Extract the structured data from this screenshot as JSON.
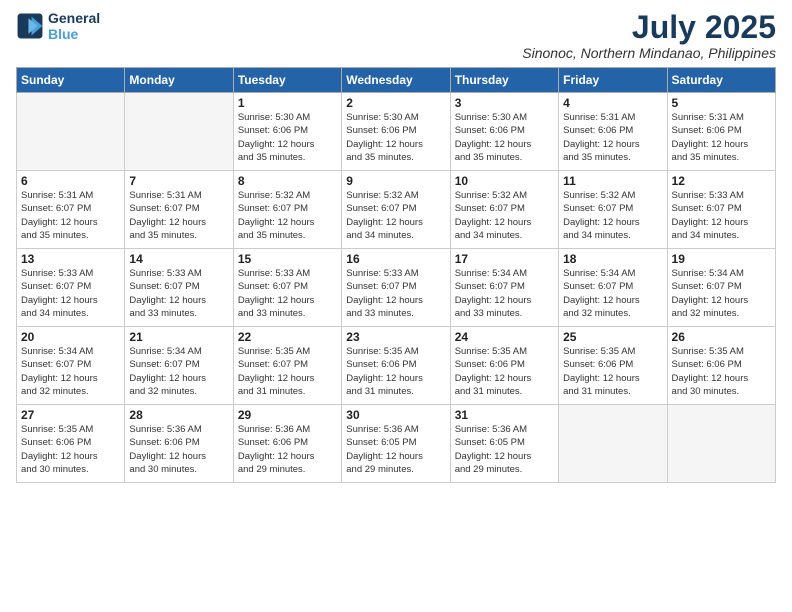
{
  "logo": {
    "line1": "General",
    "line2": "Blue"
  },
  "title": "July 2025",
  "subtitle": "Sinonoc, Northern Mindanao, Philippines",
  "headers": [
    "Sunday",
    "Monday",
    "Tuesday",
    "Wednesday",
    "Thursday",
    "Friday",
    "Saturday"
  ],
  "weeks": [
    [
      {
        "day": "",
        "info": ""
      },
      {
        "day": "",
        "info": ""
      },
      {
        "day": "1",
        "info": "Sunrise: 5:30 AM\nSunset: 6:06 PM\nDaylight: 12 hours\nand 35 minutes."
      },
      {
        "day": "2",
        "info": "Sunrise: 5:30 AM\nSunset: 6:06 PM\nDaylight: 12 hours\nand 35 minutes."
      },
      {
        "day": "3",
        "info": "Sunrise: 5:30 AM\nSunset: 6:06 PM\nDaylight: 12 hours\nand 35 minutes."
      },
      {
        "day": "4",
        "info": "Sunrise: 5:31 AM\nSunset: 6:06 PM\nDaylight: 12 hours\nand 35 minutes."
      },
      {
        "day": "5",
        "info": "Sunrise: 5:31 AM\nSunset: 6:06 PM\nDaylight: 12 hours\nand 35 minutes."
      }
    ],
    [
      {
        "day": "6",
        "info": "Sunrise: 5:31 AM\nSunset: 6:07 PM\nDaylight: 12 hours\nand 35 minutes."
      },
      {
        "day": "7",
        "info": "Sunrise: 5:31 AM\nSunset: 6:07 PM\nDaylight: 12 hours\nand 35 minutes."
      },
      {
        "day": "8",
        "info": "Sunrise: 5:32 AM\nSunset: 6:07 PM\nDaylight: 12 hours\nand 35 minutes."
      },
      {
        "day": "9",
        "info": "Sunrise: 5:32 AM\nSunset: 6:07 PM\nDaylight: 12 hours\nand 34 minutes."
      },
      {
        "day": "10",
        "info": "Sunrise: 5:32 AM\nSunset: 6:07 PM\nDaylight: 12 hours\nand 34 minutes."
      },
      {
        "day": "11",
        "info": "Sunrise: 5:32 AM\nSunset: 6:07 PM\nDaylight: 12 hours\nand 34 minutes."
      },
      {
        "day": "12",
        "info": "Sunrise: 5:33 AM\nSunset: 6:07 PM\nDaylight: 12 hours\nand 34 minutes."
      }
    ],
    [
      {
        "day": "13",
        "info": "Sunrise: 5:33 AM\nSunset: 6:07 PM\nDaylight: 12 hours\nand 34 minutes."
      },
      {
        "day": "14",
        "info": "Sunrise: 5:33 AM\nSunset: 6:07 PM\nDaylight: 12 hours\nand 33 minutes."
      },
      {
        "day": "15",
        "info": "Sunrise: 5:33 AM\nSunset: 6:07 PM\nDaylight: 12 hours\nand 33 minutes."
      },
      {
        "day": "16",
        "info": "Sunrise: 5:33 AM\nSunset: 6:07 PM\nDaylight: 12 hours\nand 33 minutes."
      },
      {
        "day": "17",
        "info": "Sunrise: 5:34 AM\nSunset: 6:07 PM\nDaylight: 12 hours\nand 33 minutes."
      },
      {
        "day": "18",
        "info": "Sunrise: 5:34 AM\nSunset: 6:07 PM\nDaylight: 12 hours\nand 32 minutes."
      },
      {
        "day": "19",
        "info": "Sunrise: 5:34 AM\nSunset: 6:07 PM\nDaylight: 12 hours\nand 32 minutes."
      }
    ],
    [
      {
        "day": "20",
        "info": "Sunrise: 5:34 AM\nSunset: 6:07 PM\nDaylight: 12 hours\nand 32 minutes."
      },
      {
        "day": "21",
        "info": "Sunrise: 5:34 AM\nSunset: 6:07 PM\nDaylight: 12 hours\nand 32 minutes."
      },
      {
        "day": "22",
        "info": "Sunrise: 5:35 AM\nSunset: 6:07 PM\nDaylight: 12 hours\nand 31 minutes."
      },
      {
        "day": "23",
        "info": "Sunrise: 5:35 AM\nSunset: 6:06 PM\nDaylight: 12 hours\nand 31 minutes."
      },
      {
        "day": "24",
        "info": "Sunrise: 5:35 AM\nSunset: 6:06 PM\nDaylight: 12 hours\nand 31 minutes."
      },
      {
        "day": "25",
        "info": "Sunrise: 5:35 AM\nSunset: 6:06 PM\nDaylight: 12 hours\nand 31 minutes."
      },
      {
        "day": "26",
        "info": "Sunrise: 5:35 AM\nSunset: 6:06 PM\nDaylight: 12 hours\nand 30 minutes."
      }
    ],
    [
      {
        "day": "27",
        "info": "Sunrise: 5:35 AM\nSunset: 6:06 PM\nDaylight: 12 hours\nand 30 minutes."
      },
      {
        "day": "28",
        "info": "Sunrise: 5:36 AM\nSunset: 6:06 PM\nDaylight: 12 hours\nand 30 minutes."
      },
      {
        "day": "29",
        "info": "Sunrise: 5:36 AM\nSunset: 6:06 PM\nDaylight: 12 hours\nand 29 minutes."
      },
      {
        "day": "30",
        "info": "Sunrise: 5:36 AM\nSunset: 6:05 PM\nDaylight: 12 hours\nand 29 minutes."
      },
      {
        "day": "31",
        "info": "Sunrise: 5:36 AM\nSunset: 6:05 PM\nDaylight: 12 hours\nand 29 minutes."
      },
      {
        "day": "",
        "info": ""
      },
      {
        "day": "",
        "info": ""
      }
    ]
  ]
}
